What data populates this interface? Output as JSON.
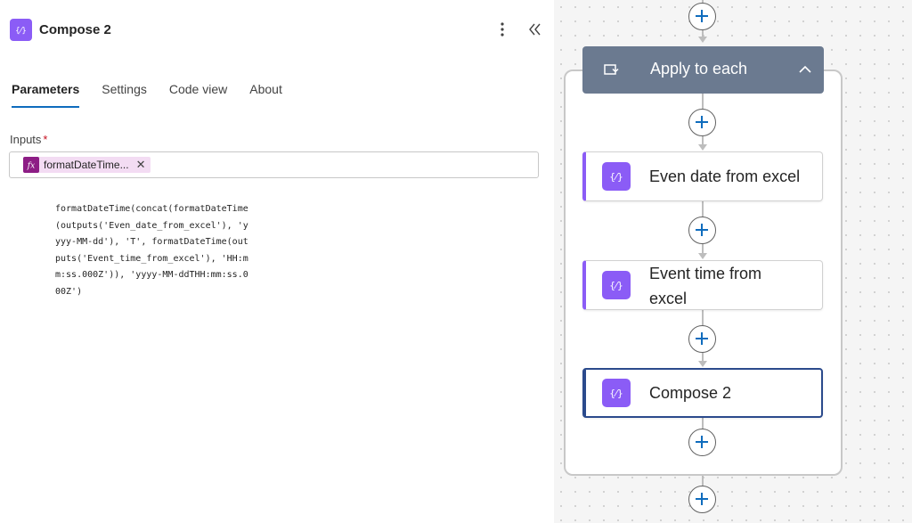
{
  "panel": {
    "title": "Compose 2",
    "tabs": [
      {
        "label": "Parameters"
      },
      {
        "label": "Settings"
      },
      {
        "label": "Code view"
      },
      {
        "label": "About"
      }
    ],
    "inputs_label": "Inputs",
    "required_marker": "*",
    "token": {
      "icon": "fx-icon",
      "label": "formatDateTime..."
    },
    "expression": "formatDateTime(concat(formatDateTime(outputs('Even_date_from_excel'), 'yyyy-MM-dd'), 'T', formatDateTime(outputs('Event_time_from_excel'), 'HH:mm:ss.000Z')), 'yyyy-MM-ddTHH:mm:ss.000Z')"
  },
  "flow": {
    "loop": {
      "title": "Apply to each",
      "icon": "loop-icon"
    },
    "actions": [
      {
        "title": "Even date from excel",
        "icon": "compose-icon"
      },
      {
        "title": "Event time from excel",
        "icon": "compose-icon"
      },
      {
        "title": "Compose 2",
        "icon": "compose-icon",
        "selected": true
      }
    ]
  },
  "colors": {
    "accent": "#0f6cbd",
    "compose": "#8b5cf6",
    "loop_header": "#6b7a90",
    "expression_token": "#8d1d85"
  }
}
